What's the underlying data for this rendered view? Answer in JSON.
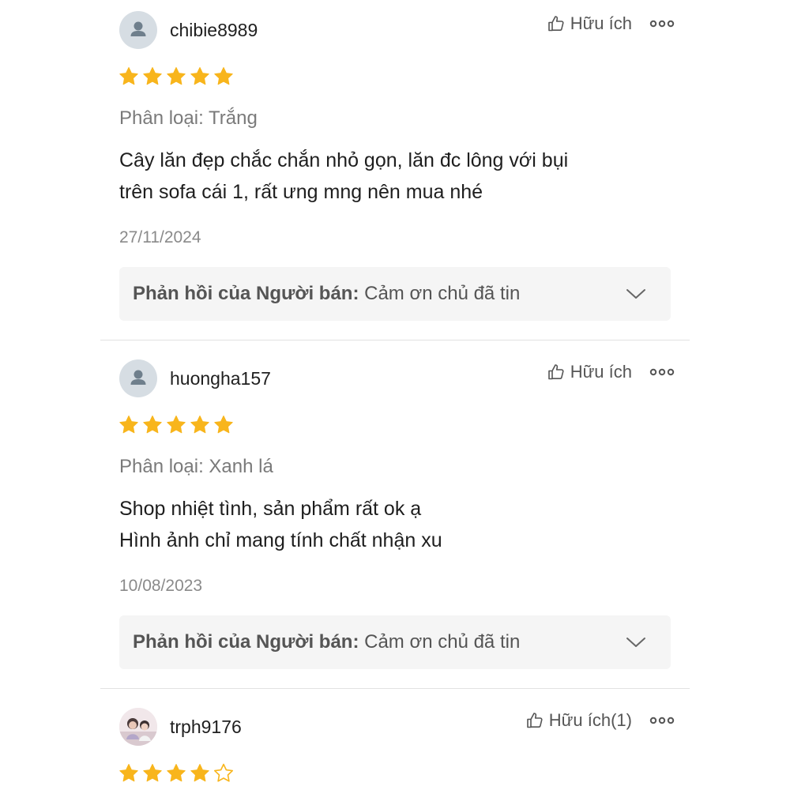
{
  "reviews": [
    {
      "username": "chibie8989",
      "avatar": "default-user-icon",
      "rating": 5,
      "max_rating": 5,
      "helpful_label": "Hữu ích",
      "variant": "Phân loại: Trắng",
      "comment_lines": [
        "Cây lăn đẹp chắc chắn nhỏ gọn, lăn đc lông với bụi",
        "trên sofa cái 1, rất ưng mng nên mua nhé"
      ],
      "date": "27/11/2024",
      "seller_reply_label": "Phản hồi của Người bán:",
      "seller_reply_text": "Cảm ơn chủ đã tin"
    },
    {
      "username": "huongha157",
      "avatar": "default-user-icon",
      "rating": 5,
      "max_rating": 5,
      "helpful_label": "Hữu ích",
      "variant": "Phân loại: Xanh lá",
      "comment_lines": [
        "Shop nhiệt tình, sản phẩm rất ok ạ",
        "Hình ảnh chỉ mang tính chất nhận xu"
      ],
      "date": "10/08/2023",
      "seller_reply_label": "Phản hồi của Người bán:",
      "seller_reply_text": "Cảm ơn chủ đã tin"
    },
    {
      "username": "trph9176",
      "avatar": "photo-avatar",
      "rating": 4,
      "max_rating": 5,
      "helpful_label": "Hữu ích(1)"
    }
  ],
  "colors": {
    "star": "#f8b51c",
    "star_empty_stroke": "#f8b51c",
    "avatar_bg": "#d6dde3",
    "avatar_icon": "#6f7f8c",
    "reply_bg": "#f5f5f5",
    "divider": "#e2e2e2"
  }
}
